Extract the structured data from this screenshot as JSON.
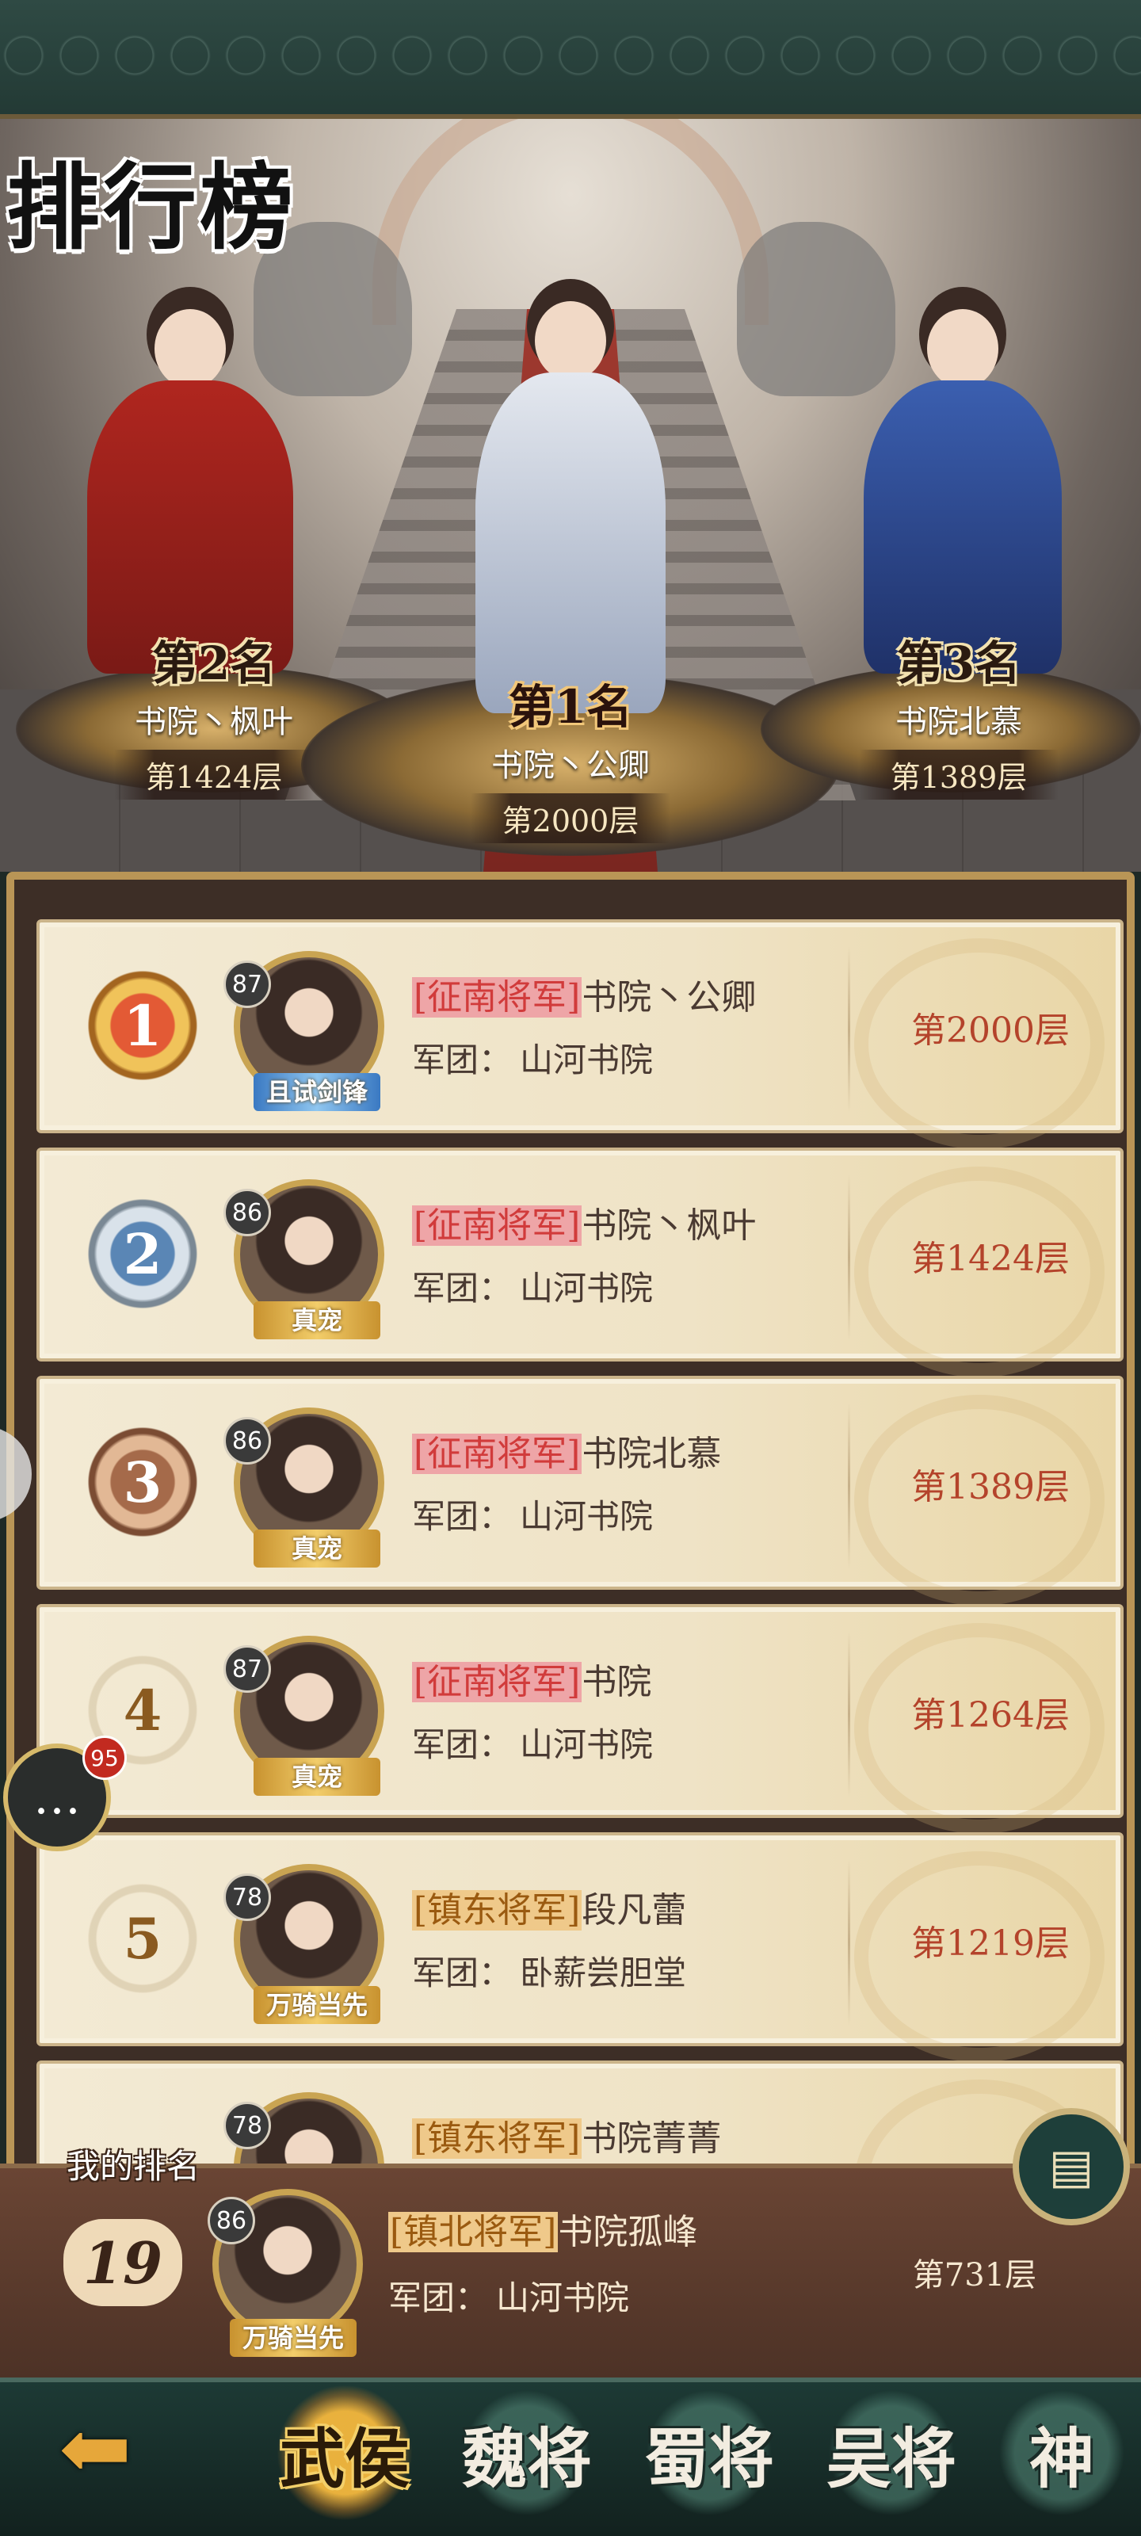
{
  "title": "排行榜",
  "podium": [
    {
      "rank_label": "第2名",
      "name": "书院丶枫叶",
      "floor": "第1424层"
    },
    {
      "rank_label": "第1名",
      "name": "书院丶公卿",
      "floor": "第2000层"
    },
    {
      "rank_label": "第3名",
      "name": "书院北慕",
      "floor": "第1389层"
    }
  ],
  "rows": [
    {
      "rank": "1",
      "level": "87",
      "title": "[征南将军]",
      "name": "书院丶公卿",
      "legion_label": "军团：",
      "legion": "山河书院",
      "floor": "第2000层",
      "avatar_tag": "且试剑锋"
    },
    {
      "rank": "2",
      "level": "86",
      "title": "[征南将军]",
      "name": "书院丶枫叶",
      "legion_label": "军团：",
      "legion": "山河书院",
      "floor": "第1424层",
      "avatar_tag": "真宠"
    },
    {
      "rank": "3",
      "level": "86",
      "title": "[征南将军]",
      "name": "书院北慕",
      "legion_label": "军团：",
      "legion": "山河书院",
      "floor": "第1389层",
      "avatar_tag": "真宠"
    },
    {
      "rank": "4",
      "level": "87",
      "title": "[征南将军]",
      "name": "书院",
      "legion_label": "军团：",
      "legion": "山河书院",
      "floor": "第1264层",
      "avatar_tag": "真宠"
    },
    {
      "rank": "5",
      "level": "78",
      "title": "[镇东将军]",
      "name": "段凡蕾",
      "legion_label": "军团：",
      "legion": "卧薪尝胆堂",
      "floor": "第1219层",
      "avatar_tag": "万骑当先"
    },
    {
      "rank": "",
      "level": "78",
      "title": "[镇东将军]",
      "name": "书院菁菁",
      "legion_label": "",
      "legion": "",
      "floor": "",
      "avatar_tag": ""
    }
  ],
  "my_rank": {
    "label": "我的排名",
    "rank": "19",
    "level": "86",
    "title": "[镇北将军]",
    "name": "书院孤峰",
    "legion_label": "军团：",
    "legion": "山河书院",
    "floor": "第731层",
    "avatar_tag": "万骑当先"
  },
  "chat_badge": "95",
  "nav": {
    "back_icon": "left-arrow-icon",
    "tabs": [
      "武侯",
      "魏将",
      "蜀将",
      "吴将",
      "神"
    ]
  },
  "colors": {
    "accent_gold": "#c9a452",
    "title_red": "#d13b3b",
    "floor_red": "#b4432b"
  }
}
